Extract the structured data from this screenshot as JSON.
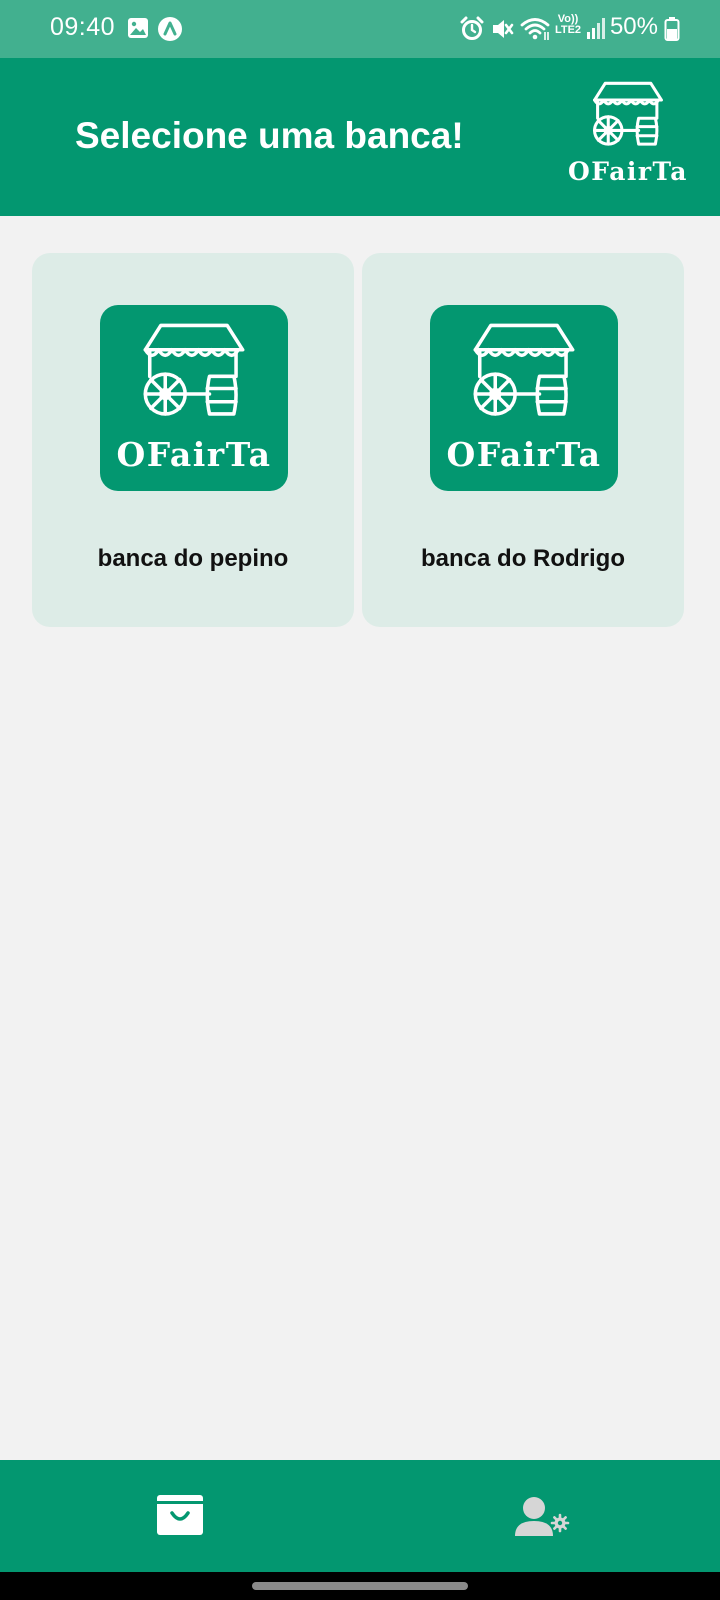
{
  "status_bar": {
    "time": "09:40",
    "battery": "50%",
    "network": "LTE2",
    "icons": [
      "image-icon",
      "app-notification-icon",
      "alarm-icon",
      "mute-icon",
      "wifi-icon",
      "lte-icon",
      "signal-icon",
      "battery-icon"
    ]
  },
  "header": {
    "title": "Selecione uma banca!",
    "logo_text": "OFairTa",
    "background": "#039770"
  },
  "stalls": [
    {
      "name": "banca do pepino",
      "logo_text": "OFairTa"
    },
    {
      "name": "banca do Rodrigo",
      "logo_text": "OFairTa"
    }
  ],
  "bottom_nav": {
    "items": [
      {
        "icon": "shopping-basket-icon"
      },
      {
        "icon": "user-settings-icon"
      }
    ]
  },
  "colors": {
    "primary": "#039770",
    "status_bar": "#42b08f",
    "card_background": "#ddece7",
    "page_background": "#f2f2f2"
  }
}
